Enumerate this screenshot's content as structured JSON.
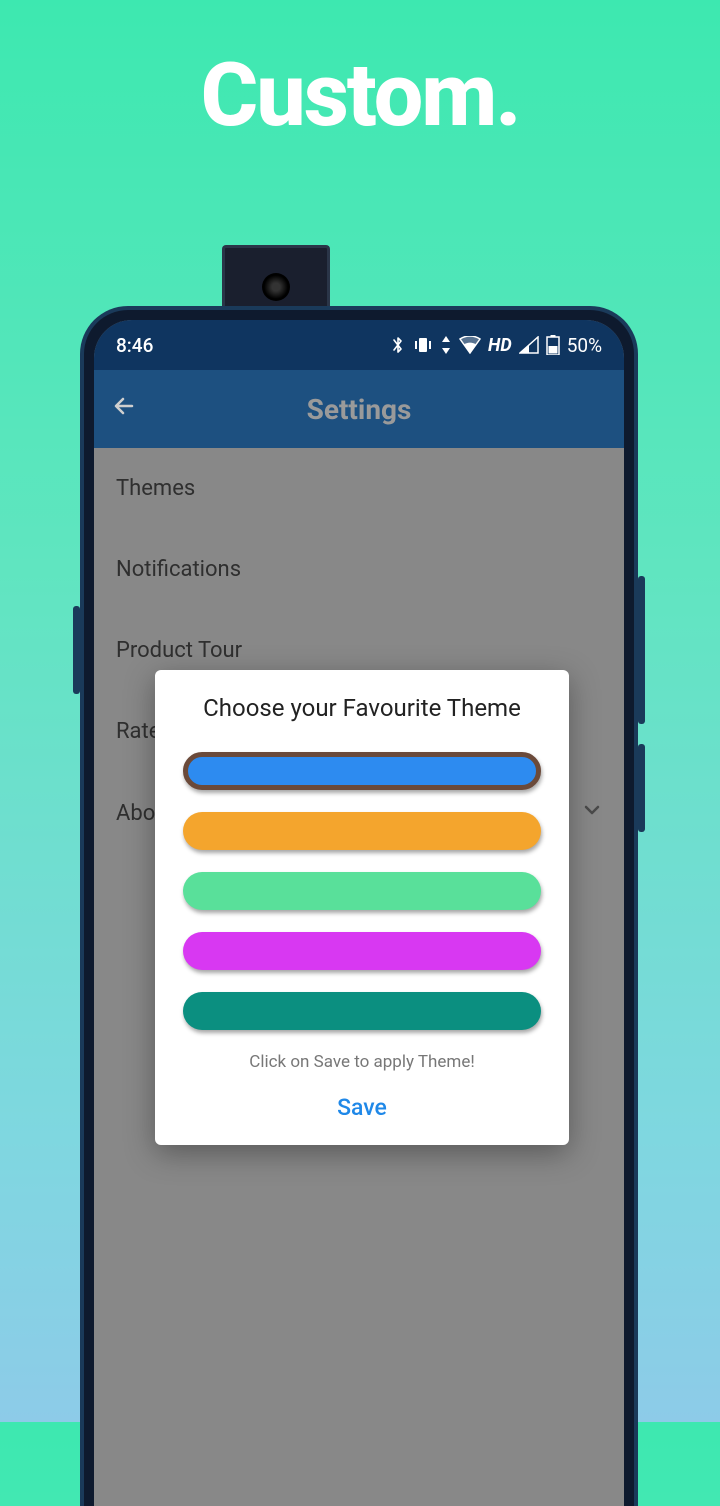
{
  "promo": {
    "title": "Custom."
  },
  "status": {
    "time": "8:46",
    "battery": "50%"
  },
  "appbar": {
    "title": "Settings"
  },
  "settings": {
    "items": [
      "Themes",
      "Notifications",
      "Product Tour",
      "Rate",
      "About"
    ]
  },
  "modal": {
    "title": "Choose your Favourite Theme",
    "themes": [
      {
        "color": "#2d8bf0",
        "selected": true
      },
      {
        "color": "#f4a52d",
        "selected": false
      },
      {
        "color": "#59e09a",
        "selected": false
      },
      {
        "color": "#d838f2",
        "selected": false
      },
      {
        "color": "#0b8f80",
        "selected": false
      }
    ],
    "hint": "Click on Save to apply Theme!",
    "save": "Save"
  }
}
